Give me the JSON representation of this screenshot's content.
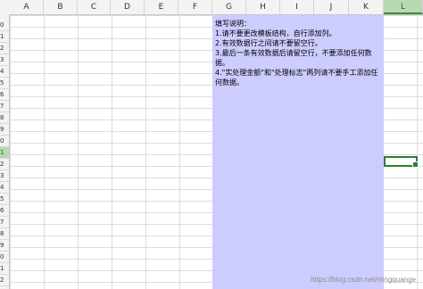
{
  "columns": [
    "A",
    "B",
    "C",
    "D",
    "E",
    "F",
    "G",
    "H",
    "I",
    "J",
    "K",
    "L"
  ],
  "selected_column": "L",
  "row_labels": [
    "0",
    "1",
    "2",
    "3",
    "4",
    "5",
    "6",
    "7",
    "8",
    "9",
    "0",
    "1",
    "2",
    "3",
    "4",
    "5",
    "6",
    "7",
    "8",
    "9",
    "0",
    "1",
    "2"
  ],
  "selected_row_index": 11,
  "instructions": {
    "lines": [
      "填写说明：",
      "1.请不要更改模板结构，自行添加列。",
      "2.有效数据行之间请不要留空行。",
      "3.最后一条有效数据后请留空行，不要添加任何数据。",
      "4.\"实处理金额\"和\"处理标志\"两列请不要手工添加任何数据。"
    ]
  },
  "watermark": "https://blog.csdn.net/mingquange",
  "colors": {
    "instruction_fill": "#ccccff",
    "selection_green": "#2f7d32"
  }
}
